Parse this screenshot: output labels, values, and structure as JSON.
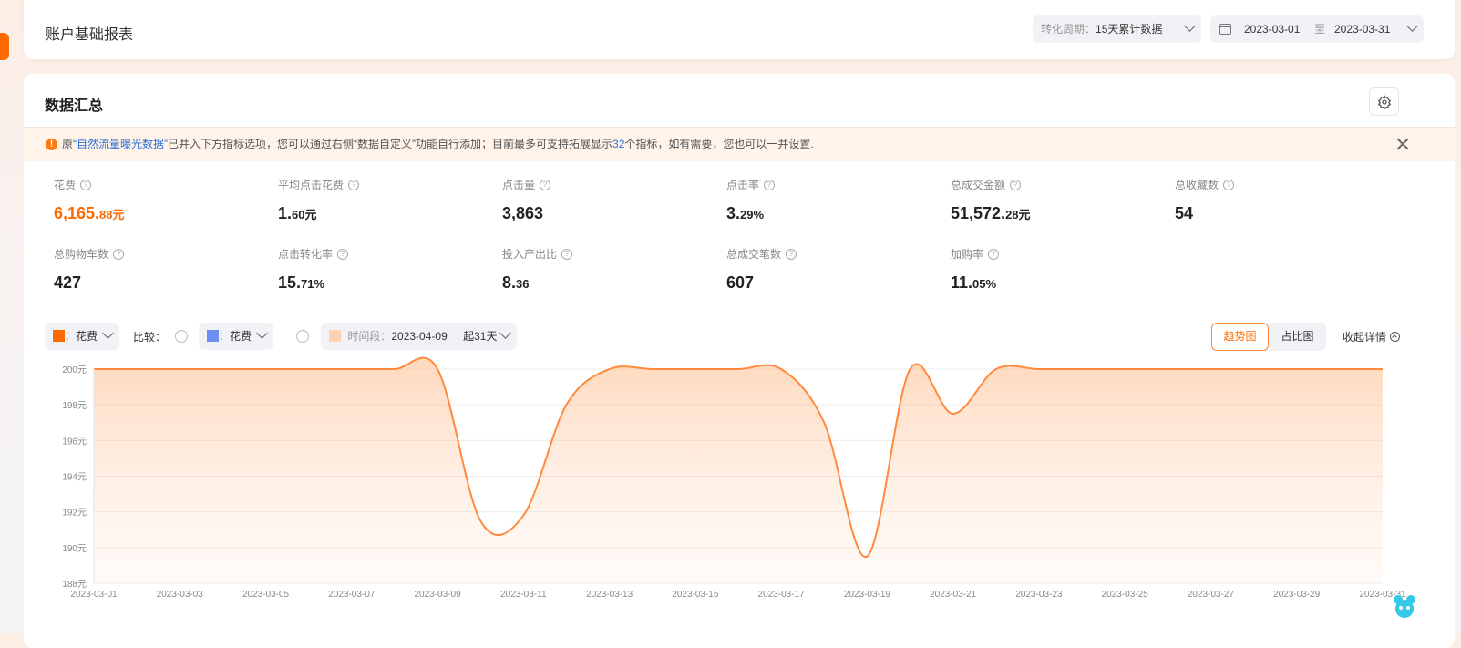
{
  "header": {
    "title": "账户基础报表",
    "cut_left": "····",
    "cut_right": "",
    "period": {
      "label": "转化周期：",
      "value": "15天累计数据"
    },
    "date_range": {
      "start": "2023-03-01",
      "sep": "至",
      "end": "2023-03-31"
    }
  },
  "summary": {
    "title": "数据汇总",
    "notice": {
      "pre": "原",
      "highlight": "“自然流量曝光数据”",
      "mid": "已并入下方指标选项，您可以通过右侧“数据自定义”功能自行添加；目前最多可支持拓展显示",
      "count": "32",
      "post": "个指标，如有需要，您也可以一并设置."
    },
    "metrics": [
      {
        "name": "花费",
        "int": "6,165.",
        "dec": "88元",
        "orange": true
      },
      {
        "name": "平均点击花费",
        "int": "1.",
        "dec": "60元"
      },
      {
        "name": "点击量",
        "int": "3,863",
        "dec": ""
      },
      {
        "name": "点击率",
        "int": "3.",
        "dec": "29%"
      },
      {
        "name": "总成交金额",
        "int": "51,572.",
        "dec": "28元"
      },
      {
        "name": "总收藏数",
        "int": "54",
        "dec": ""
      },
      {
        "name": "总购物车数",
        "int": "427",
        "dec": ""
      },
      {
        "name": "点击转化率",
        "int": "15.",
        "dec": "71%"
      },
      {
        "name": "投入产出比",
        "int": "8.",
        "dec": "36"
      },
      {
        "name": "总成交笔数",
        "int": "607",
        "dec": ""
      },
      {
        "name": "加购率",
        "int": "11.",
        "dec": "05%"
      }
    ]
  },
  "controls": {
    "metric_a": {
      "prefix": "：",
      "label": "花费",
      "color": "#ff6a00"
    },
    "compare_label": "比较：",
    "metric_b": {
      "prefix": "：",
      "label": "花费",
      "color": "#6e8ff0"
    },
    "time": {
      "label": "时间段：",
      "date": "2023-04-09",
      "range": "起31天",
      "color": "#ffd2b3"
    },
    "view_trend": "趋势图",
    "view_share": "占比图",
    "collapse": "收起详情"
  },
  "chart_data": {
    "type": "area",
    "series": [
      {
        "name": "花费",
        "color": "#ff8a3d",
        "x": [
          "2023-03-01",
          "2023-03-02",
          "2023-03-03",
          "2023-03-04",
          "2023-03-05",
          "2023-03-06",
          "2023-03-07",
          "2023-03-08",
          "2023-03-09",
          "2023-03-10",
          "2023-03-11",
          "2023-03-12",
          "2023-03-13",
          "2023-03-14",
          "2023-03-15",
          "2023-03-16",
          "2023-03-17",
          "2023-03-18",
          "2023-03-19",
          "2023-03-20",
          "2023-03-21",
          "2023-03-22",
          "2023-03-23",
          "2023-03-24",
          "2023-03-25",
          "2023-03-26",
          "2023-03-27",
          "2023-03-28",
          "2023-03-29",
          "2023-03-30",
          "2023-03-31"
        ],
        "values": [
          200,
          200,
          200,
          200,
          200,
          200,
          200,
          200,
          200,
          191.5,
          191.8,
          198,
          200,
          200,
          200,
          200,
          200,
          197,
          189.5,
          200,
          197.5,
          200,
          200,
          200,
          200,
          200,
          200,
          200,
          200,
          200,
          200
        ]
      }
    ],
    "x_ticks": [
      "2023-03-01",
      "2023-03-03",
      "2023-03-05",
      "2023-03-07",
      "2023-03-09",
      "2023-03-11",
      "2023-03-13",
      "2023-03-15",
      "2023-03-17",
      "2023-03-19",
      "2023-03-21",
      "2023-03-23",
      "2023-03-25",
      "2023-03-27",
      "2023-03-29",
      "2023-03-31"
    ],
    "y_ticks": [
      "200元",
      "198元",
      "196元",
      "194元",
      "192元",
      "190元",
      "188元"
    ],
    "y_values": [
      200,
      198,
      196,
      194,
      192,
      190,
      188
    ],
    "ylim": [
      188,
      200
    ],
    "grid": true
  }
}
